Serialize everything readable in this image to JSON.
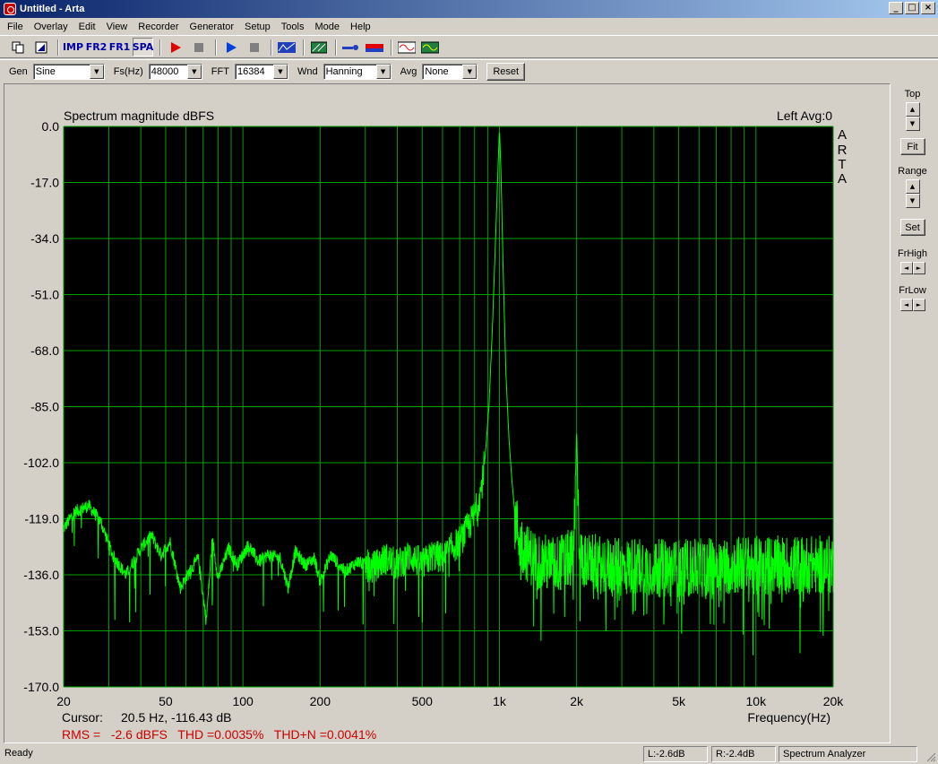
{
  "window": {
    "title": "Untitled - Arta",
    "minimize": "_",
    "maximize": "□",
    "close": "×"
  },
  "menu": [
    "File",
    "Overlay",
    "Edit",
    "View",
    "Recorder",
    "Generator",
    "Setup",
    "Tools",
    "Mode",
    "Help"
  ],
  "toolbar": {
    "imp_label": "IMP",
    "fr2_label": "FR2",
    "fr1_label": "FR1",
    "spa_label": "SPA",
    "active_mode": "SPA"
  },
  "params": {
    "gen_label": "Gen",
    "gen_value": "Sine",
    "fs_label": "Fs(Hz)",
    "fs_value": "48000",
    "fft_label": "FFT",
    "fft_value": "16384",
    "wnd_label": "Wnd",
    "wnd_value": "Hanning",
    "avg_label": "Avg",
    "avg_value": "None",
    "reset_label": "Reset"
  },
  "side_panel": {
    "top_label": "Top",
    "fit_label": "Fit",
    "range_label": "Range",
    "set_label": "Set",
    "frhigh_label": "FrHigh",
    "frlow_label": "FrLow"
  },
  "plot": {
    "title": "Spectrum magnitude dBFS",
    "channel_info": "Left  Avg:0",
    "watermark": [
      "A",
      "R",
      "T",
      "A"
    ],
    "cursor_label": "Cursor:",
    "cursor_value": "20.5 Hz, -116.43 dB",
    "measurements": "RMS =   -2.6 dBFS   THD =0.0035%   THD+N =0.0041%",
    "colors": {
      "background": "#000000",
      "grid": "#00a000",
      "trace": "#00ff00",
      "measure_text": "#cc0000"
    }
  },
  "chart_data": {
    "type": "line",
    "x_scale": "log",
    "xlim": [
      20,
      20000
    ],
    "ylim": [
      -170,
      0
    ],
    "xlabel": "Frequency(Hz)",
    "x_ticks": [
      {
        "v": 20,
        "label": "20"
      },
      {
        "v": 50,
        "label": "50"
      },
      {
        "v": 100,
        "label": "100"
      },
      {
        "v": 200,
        "label": "200"
      },
      {
        "v": 500,
        "label": "500"
      },
      {
        "v": 1000,
        "label": "1k"
      },
      {
        "v": 2000,
        "label": "2k"
      },
      {
        "v": 5000,
        "label": "5k"
      },
      {
        "v": 10000,
        "label": "10k"
      },
      {
        "v": 20000,
        "label": "20k"
      }
    ],
    "y_ticks": [
      "0.0",
      "-17.0",
      "-34.0",
      "-51.0",
      "-68.0",
      "-85.0",
      "-102.0",
      "-119.0",
      "-136.0",
      "-153.0",
      "-170.0"
    ],
    "x": [
      20,
      22,
      25,
      28,
      31,
      35,
      40,
      44,
      48,
      52,
      57,
      62,
      67,
      72,
      76,
      80,
      88,
      95,
      105,
      115,
      125,
      140,
      150,
      160,
      175,
      190,
      200,
      220,
      250,
      280,
      320,
      360,
      400,
      450,
      500,
      550,
      600,
      650,
      700,
      750,
      800,
      850,
      880,
      910,
      940,
      965,
      985,
      995,
      1000,
      1005,
      1015,
      1035,
      1060,
      1090,
      1120,
      1150,
      1200,
      1300,
      1450,
      1600,
      1800,
      1950,
      2000,
      2050,
      2200,
      2500,
      3000,
      3500,
      4000,
      5000,
      6000,
      7000,
      8000,
      9000,
      10000,
      12000,
      14000,
      16000,
      18000,
      20000
    ],
    "y": [
      -122,
      -117,
      -115,
      -120,
      -130,
      -136,
      -128,
      -124,
      -130,
      -126,
      -140,
      -135,
      -131,
      -150,
      -125,
      -137,
      -128,
      -133,
      -127,
      -132,
      -130,
      -131,
      -140,
      -129,
      -133,
      -131,
      -138,
      -130,
      -135,
      -132,
      -134,
      -131,
      -133,
      -130,
      -133,
      -130,
      -131,
      -128,
      -126,
      -122,
      -118,
      -110,
      -100,
      -85,
      -60,
      -35,
      -15,
      -5,
      -1,
      -5,
      -15,
      -45,
      -75,
      -95,
      -108,
      -118,
      -126,
      -130,
      -132,
      -133,
      -132,
      -130,
      -92,
      -130,
      -132,
      -133,
      -134,
      -133,
      -134,
      -134,
      -134,
      -133,
      -133,
      -133,
      -133,
      -133,
      -133,
      -133,
      -133,
      -133
    ]
  },
  "status": {
    "ready": "Ready",
    "left_level": "L:-2.6dB",
    "right_level": "R:-2.4dB",
    "mode": "Spectrum Analyzer"
  }
}
